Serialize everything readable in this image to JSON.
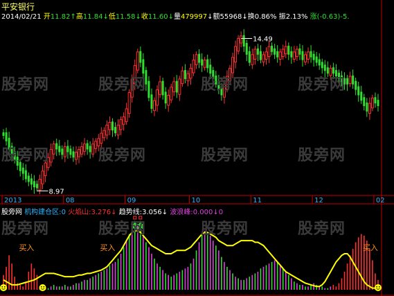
{
  "stock": {
    "name": "平安银行",
    "date": "2014/02/21",
    "open_label": "开",
    "open": "11.82",
    "open_arrow": "↑",
    "high_label": "高",
    "high": "11.84",
    "high_arrow": "↓",
    "low_label": "低",
    "low": "11.58",
    "low_arrow": "↓",
    "close_label": "收",
    "close": "11.60",
    "close_arrow": "↓",
    "volume_label": "量",
    "volume": "479997",
    "volume_arrow": "↓",
    "amount_label": "额",
    "amount": "55968",
    "amount_arrow": "↓",
    "turnover_label": "换",
    "turnover": "0.86%",
    "amplitude_label": "振",
    "amplitude": "2.13%",
    "change_label": "涨",
    "change": "(-0.63)-5."
  },
  "indicator": {
    "site": "股旁网",
    "name": "机构建仓区:",
    "name_value": "0",
    "fire_label": "火焰山:",
    "fire_value": "3.276",
    "fire_arrow": "↓",
    "trend_label": "趋势线:",
    "trend_value": "3.056",
    "trend_arrow": "↓",
    "wave_label": "波浪峰:",
    "wave_value": "0.000",
    "wave_arrow": "↓",
    "wave_extra": "0",
    "buy_label": "买入"
  },
  "watermark": "股旁网",
  "colors": {
    "up": "#ff3030",
    "down": "#30e030",
    "axis": "#c00000",
    "date_text": "#28b4ff",
    "yellow": "#ffff00",
    "white": "#ffffff",
    "magenta": "#e040e0",
    "orange": "#ff9020"
  },
  "chart_data": [
    {
      "type": "candlestick",
      "title": "平安银行",
      "x_tick_labels": [
        "2013",
        "08",
        "09",
        "10",
        "11",
        "12",
        "02"
      ],
      "annotations": [
        {
          "text": "14.49",
          "kind": "high_marker"
        },
        {
          "text": "8.97",
          "kind": "low_marker"
        }
      ],
      "ylim": [
        8.7,
        15.1
      ],
      "x_ticks_at_candle": [
        0,
        22,
        44,
        67,
        89,
        111,
        133
      ],
      "candle_count": 135,
      "close_path": [
        10.9,
        10.7,
        10.4,
        10.2,
        10.0,
        9.8,
        9.6,
        9.5,
        9.3,
        9.2,
        9.1,
        9.0,
        8.97,
        9.2,
        9.5,
        9.8,
        10.0,
        10.3,
        10.5,
        10.4,
        10.3,
        10.2,
        10.4,
        10.3,
        10.2,
        10.1,
        10.2,
        10.3,
        10.4,
        10.5,
        10.4,
        10.3,
        10.5,
        10.6,
        10.7,
        10.9,
        11.0,
        11.2,
        11.3,
        11.1,
        11.0,
        11.2,
        11.4,
        11.5,
        11.8,
        12.4,
        12.9,
        13.4,
        13.9,
        13.6,
        13.2,
        12.8,
        12.3,
        11.9,
        12.1,
        12.5,
        12.8,
        12.4,
        12.1,
        12.3,
        12.6,
        12.8,
        12.5,
        12.9,
        13.2,
        13.0,
        13.1,
        13.3,
        13.6,
        13.8,
        13.6,
        13.5,
        13.6,
        13.4,
        13.2,
        13.0,
        12.8,
        12.6,
        12.4,
        12.7,
        13.0,
        13.3,
        13.7,
        14.1,
        14.4,
        14.49,
        14.2,
        13.9,
        13.6,
        13.8,
        14.0,
        13.9,
        13.7,
        13.8,
        13.9,
        14.1,
        14.0,
        13.9,
        13.8,
        13.9,
        14.0,
        14.1,
        13.9,
        13.8,
        13.9,
        14.0,
        13.9,
        13.7,
        13.8,
        13.9,
        13.8,
        13.7,
        13.6,
        13.5,
        13.4,
        13.3,
        13.2,
        13.3,
        13.2,
        13.1,
        13.0,
        12.9,
        12.8,
        12.9,
        13.0,
        12.8,
        12.6,
        12.4,
        12.2,
        12.0,
        11.8,
        12.0,
        12.2,
        12.1,
        12.0
      ],
      "up_candles": [
        13,
        14,
        15,
        16,
        17,
        18,
        22,
        26,
        27,
        28,
        29,
        32,
        33,
        34,
        35,
        36,
        37,
        38,
        41,
        42,
        43,
        44,
        45,
        46,
        47,
        48,
        54,
        55,
        56,
        59,
        60,
        61,
        63,
        64,
        66,
        67,
        68,
        69,
        72,
        79,
        80,
        81,
        82,
        83,
        84,
        85,
        89,
        90,
        93,
        94,
        95,
        99,
        100,
        101,
        104,
        105,
        108,
        109,
        117,
        124,
        131,
        132
      ]
    },
    {
      "type": "bar",
      "title": "机构建仓区",
      "series": [
        {
          "name": "火焰山",
          "color": "red"
        },
        {
          "name": "趋势线",
          "color": "yellow"
        },
        {
          "name": "波浪峰",
          "color": "magenta"
        },
        {
          "name": "机构建仓区",
          "color": "green"
        }
      ],
      "bar_count": 135,
      "bar_values": [
        0.9,
        1.4,
        2.1,
        1.6,
        0.8,
        0.4,
        0.3,
        0.2,
        0.5,
        1.1,
        1.6,
        1.3,
        0.9,
        0.2,
        0.1,
        0.1,
        0.1,
        0.2,
        0.3,
        0.2,
        0.2,
        0.2,
        0.3,
        0.2,
        0.2,
        0.3,
        0.4,
        0.4,
        0.5,
        0.6,
        0.6,
        0.7,
        0.8,
        0.9,
        1.0,
        1.1,
        1.2,
        1.3,
        1.5,
        1.6,
        1.7,
        1.9,
        2.2,
        2.6,
        3.0,
        3.4,
        3.8,
        4.0,
        3.9,
        3.6,
        3.3,
        2.9,
        2.6,
        2.2,
        1.9,
        1.6,
        1.4,
        1.2,
        1.0,
        0.9,
        0.8,
        0.9,
        1.0,
        1.1,
        1.2,
        1.3,
        1.4,
        1.6,
        1.9,
        2.4,
        2.9,
        3.4,
        3.6,
        3.5,
        3.3,
        3.0,
        2.7,
        2.4,
        2.0,
        1.7,
        1.4,
        1.2,
        1.0,
        0.8,
        0.7,
        0.6,
        0.6,
        0.7,
        0.8,
        0.9,
        1.0,
        1.1,
        1.3,
        1.4,
        1.5,
        1.6,
        1.7,
        1.8,
        1.7,
        1.5,
        1.3,
        1.1,
        0.9,
        0.7,
        0.5,
        0.4,
        0.3,
        0.3,
        0.2,
        0.2,
        0.3,
        0.4,
        0.3,
        0.2,
        0.2,
        0.1,
        0.1,
        0.2,
        0.3,
        0.2,
        0.4,
        0.7,
        1.1,
        1.6,
        2.1,
        2.5,
        2.9,
        3.2,
        3.4,
        3.3,
        3.0,
        2.5,
        1.8,
        1.0,
        0.6
      ],
      "bar_color_by_index": {
        "red": [
          [
            0,
            12
          ],
          [
            118,
            134
          ]
        ],
        "magenta": [
          [
            40,
            52
          ],
          [
            66,
            74
          ]
        ],
        "green_purple_alternate": [
          [
            13,
            117
          ]
        ]
      },
      "trend_line": [
        0.6,
        0.5,
        0.4,
        0.3,
        0.3,
        0.3,
        0.35,
        0.4,
        0.45,
        0.5,
        0.55,
        0.6,
        0.7,
        0.8,
        0.9,
        1.0,
        1.0,
        1.0,
        1.0,
        0.95,
        0.9,
        0.85,
        0.8,
        0.8,
        0.8,
        0.8,
        0.85,
        0.9,
        0.9,
        0.95,
        1.0,
        1.0,
        1.05,
        1.1,
        1.15,
        1.2,
        1.3,
        1.4,
        1.6,
        1.8,
        2.0,
        2.2,
        2.4,
        2.7,
        3.0,
        3.3,
        3.5,
        3.6,
        3.6,
        3.5,
        3.3,
        3.1,
        2.9,
        2.7,
        2.6,
        2.5,
        2.4,
        2.3,
        2.2,
        2.2,
        2.2,
        2.3,
        2.4,
        2.4,
        2.4,
        2.4,
        2.5,
        2.6,
        2.8,
        3.0,
        3.2,
        3.4,
        3.5,
        3.5,
        3.4,
        3.3,
        3.2,
        3.0,
        2.9,
        2.8,
        2.7,
        2.7,
        2.7,
        2.8,
        2.9,
        3.0,
        3.0,
        3.0,
        3.0,
        3.0,
        2.9,
        2.9,
        2.8,
        2.7,
        2.5,
        2.3,
        2.1,
        1.9,
        1.7,
        1.5,
        1.3,
        1.1,
        1.0,
        0.9,
        0.8,
        0.7,
        0.6,
        0.5,
        0.4,
        0.35,
        0.3,
        0.25,
        0.2,
        0.2,
        0.3,
        0.5,
        0.8,
        1.1,
        1.4,
        1.7,
        1.9,
        2.1,
        2.2,
        2.2,
        2.0,
        1.7,
        1.4,
        1.1,
        0.8,
        0.5,
        0.3,
        0.2,
        0.1,
        0.1,
        0.1
      ],
      "ylim": [
        0,
        4.4
      ],
      "markers": [
        {
          "text": "买入",
          "at_bar": 8
        },
        {
          "text": "买入",
          "at_bar": 37
        },
        {
          "text": "买入",
          "at_bar": 131
        }
      ]
    }
  ]
}
